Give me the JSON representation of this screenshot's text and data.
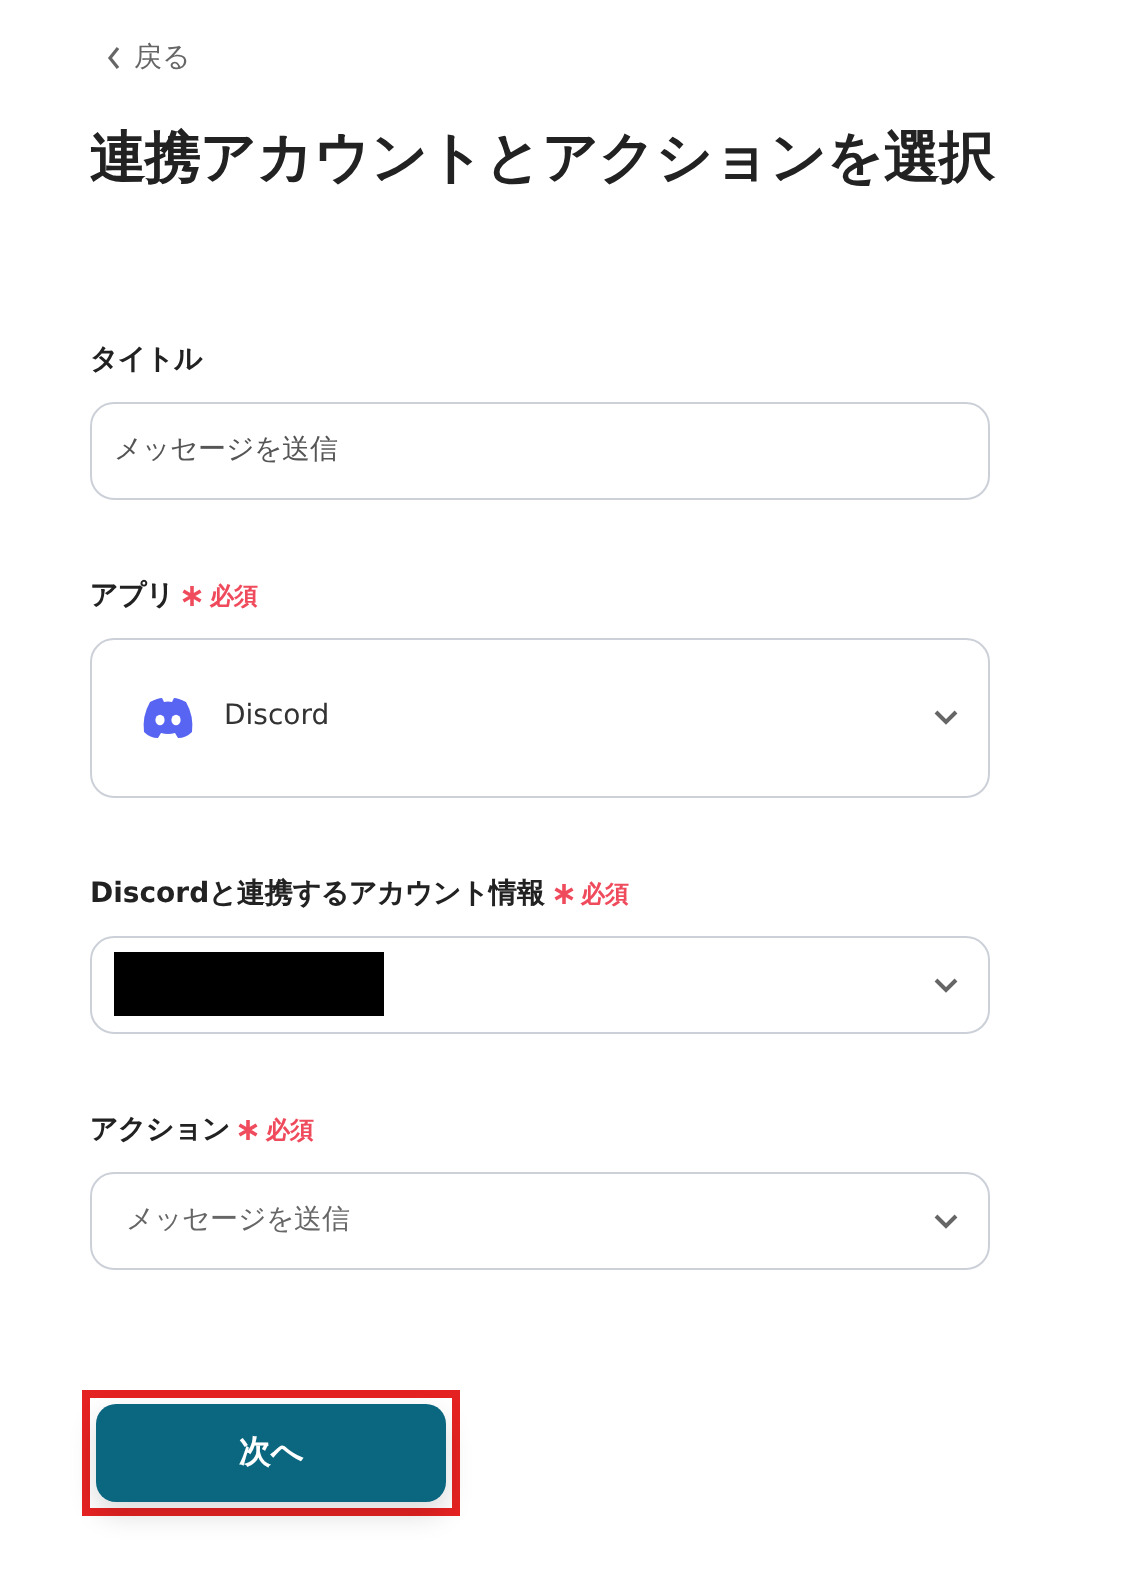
{
  "back_link": {
    "label": "戻る"
  },
  "heading": "連携アカウントとアクションを選択",
  "fields": [
    {
      "kind": "text",
      "label": "タイトル",
      "value": "メッセージを送信"
    },
    {
      "kind": "app-select",
      "label": "アプリ",
      "required": true,
      "required_label": "必須",
      "value": "Discord"
    },
    {
      "kind": "redacted-select",
      "label": "Discordと連携するアカウント情報",
      "required": true,
      "required_label": "必須"
    },
    {
      "kind": "select",
      "label": "アクション",
      "required": true,
      "required_label": "必須",
      "placeholder": "メッセージを送信"
    }
  ],
  "next_button": {
    "label": "次へ",
    "highlighted": true
  }
}
